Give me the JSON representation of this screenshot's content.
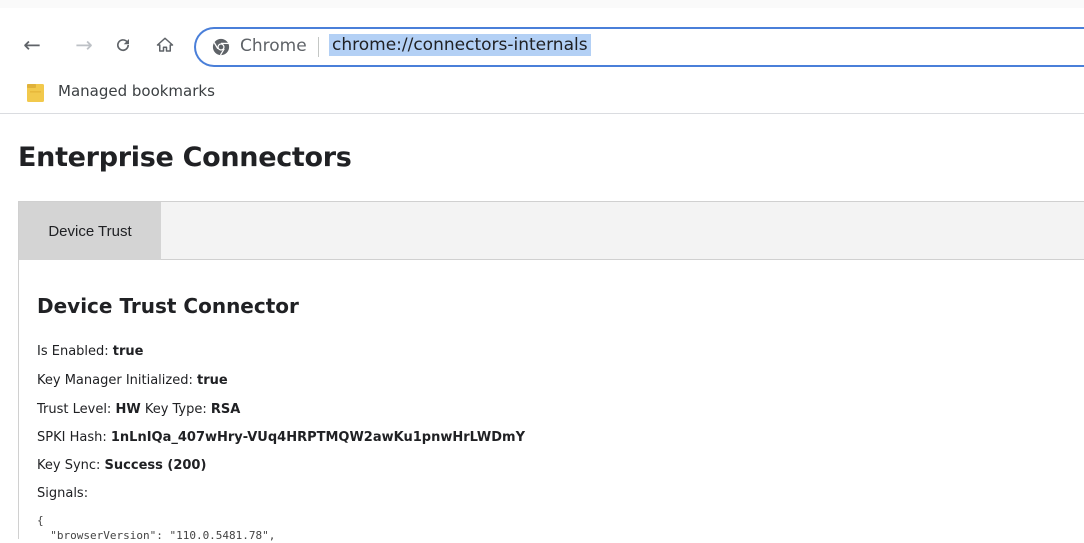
{
  "browser": {
    "omnibox": {
      "chip_label": "Chrome",
      "url": "chrome://connectors-internals"
    },
    "nav": {
      "back_icon": "arrow-left-icon",
      "forward_icon": "arrow-right-icon",
      "reload_icon": "reload-icon",
      "home_icon": "home-icon",
      "back_glyph": "←",
      "forward_glyph": "→",
      "reload_glyph": "C",
      "home_glyph": "⌂"
    },
    "bookmarks_bar": {
      "items": [
        {
          "label": "Managed bookmarks",
          "icon": "folder-icon"
        }
      ]
    }
  },
  "page": {
    "title": "Enterprise Connectors",
    "tabs": [
      {
        "label": "Device Trust",
        "selected": true
      }
    ],
    "section": {
      "title": "Device Trust Connector",
      "fields": [
        {
          "label": "Is Enabled: ",
          "value": "true"
        },
        {
          "label": "Key Manager Initialized: ",
          "value": "true"
        },
        {
          "label": "Trust Level: ",
          "value": "HW",
          "label2": " Key Type: ",
          "value2": "RSA"
        },
        {
          "label": "SPKI Hash: ",
          "value": "1nLnIQa_407wHry-VUq4HRPTMQW2awKu1pnwHrLWDmY"
        },
        {
          "label": "Key Sync: ",
          "value": "Success (200)"
        },
        {
          "label": "Signals:"
        }
      ],
      "signals_json_open": "{",
      "signals_json_line1": "  \"browserVersion\": \"110.0.5481.78\","
    }
  },
  "colors": {
    "omnibox_border": "#4a7fd9",
    "url_highlight": "#b3d0f5",
    "tab_selected": "#d4d4d4",
    "tabs_bar": "#f3f3f3",
    "folder": "#f2c94c"
  }
}
